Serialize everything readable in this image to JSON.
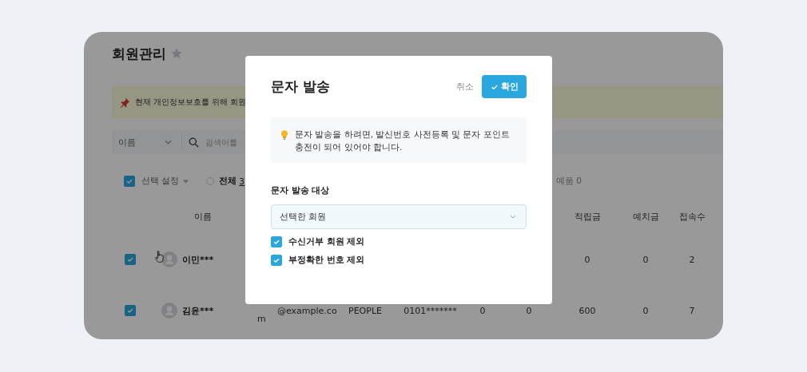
{
  "page": {
    "title": "회원관리",
    "notice": "현재 개인정보보호를 위해 회원",
    "search": {
      "field": "이름",
      "placeholder": "검색어를"
    },
    "toolbar": {
      "select_all": {
        "label": "선택 설정",
        "checked": true
      },
      "filter": {
        "label": "전체",
        "selected": false,
        "count": "3"
      },
      "column_3": "예품 0"
    },
    "table": {
      "columns": {
        "name": "이름",
        "points": "적립금",
        "deposit": "예치금",
        "visits": "접속수"
      },
      "rows": [
        {
          "checked": true,
          "name": "이민***",
          "points": "0",
          "deposit": "0",
          "visits": "2"
        },
        {
          "checked": true,
          "name": "김윤***",
          "column_3": "m",
          "column_4": "@example.co",
          "column_5": "PEOPLE",
          "column_6": "0101*******",
          "column_7": "0",
          "column_8": "0",
          "points": "600",
          "deposit": "0",
          "visits": "7"
        }
      ]
    }
  },
  "dialog": {
    "title": "문자 발송",
    "cancel": "취소",
    "confirm": "확인",
    "info": "문자 발송을 하려면, 발신번호 사전등록 및 문자 포인트 충전이 되어 있어야 합니다.",
    "target_label": "문자 발송 대상",
    "target_value": "선택한 회원",
    "options": [
      {
        "label": "수신거부 회원 제외",
        "checked": true
      },
      {
        "label": "부정확한 번호 제외",
        "checked": true
      }
    ]
  }
}
